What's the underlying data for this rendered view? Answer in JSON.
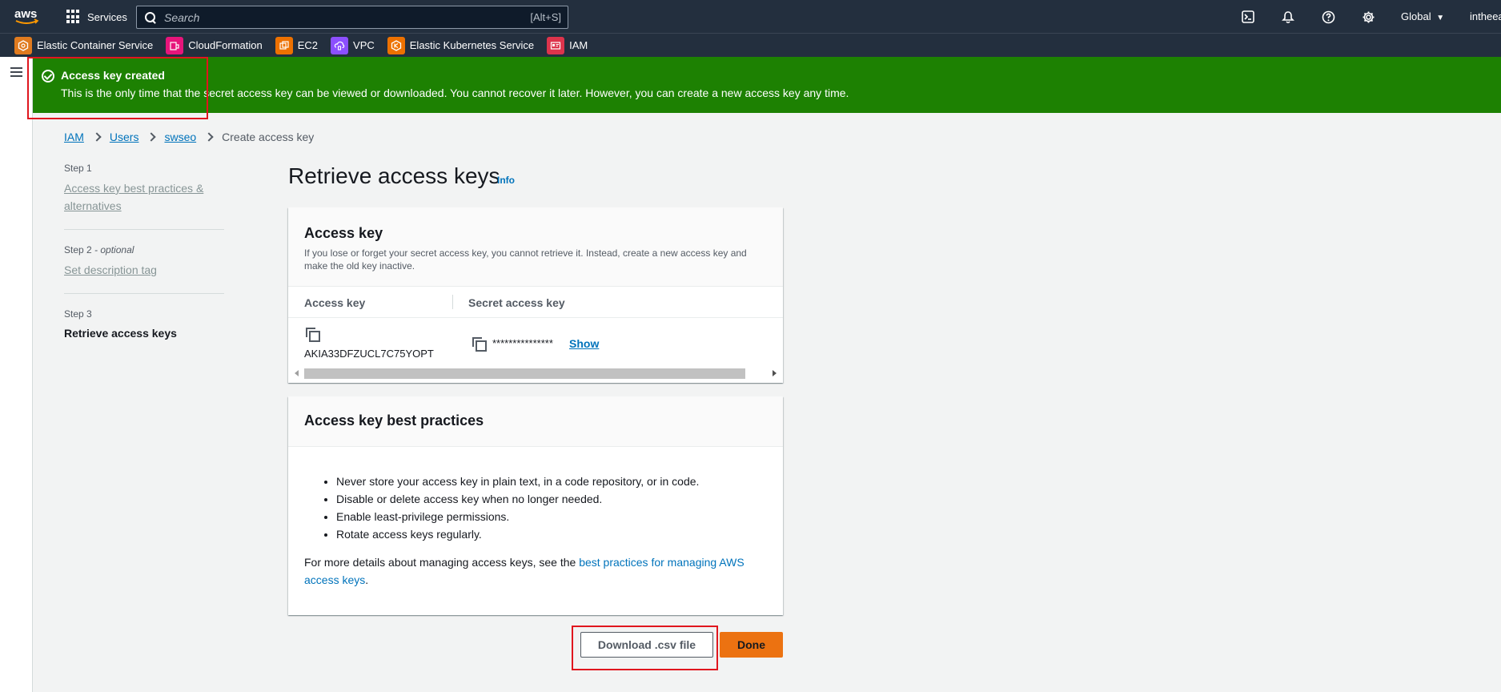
{
  "topnav": {
    "services_label": "Services",
    "search_placeholder": "Search",
    "search_shortcut": "[Alt+S]",
    "region": "Global",
    "user": "intheea"
  },
  "favorites": [
    {
      "label": "Elastic Container Service",
      "color": "#e07b1f"
    },
    {
      "label": "CloudFormation",
      "color": "#e7157b"
    },
    {
      "label": "EC2",
      "color": "#ed7100"
    },
    {
      "label": "VPC",
      "color": "#8c4fff"
    },
    {
      "label": "Elastic Kubernetes Service",
      "color": "#ed7100"
    },
    {
      "label": "IAM",
      "color": "#dd344c"
    }
  ],
  "flash": {
    "title": "Access key created",
    "message": "This is the only time that the secret access key can be viewed or downloaded. You cannot recover it later. However, you can create a new access key any time."
  },
  "breadcrumb": {
    "items": [
      "IAM",
      "Users",
      "swseo"
    ],
    "current": "Create access key"
  },
  "steps": [
    {
      "number": "Step 1",
      "label": "Access key best practices & alternatives"
    },
    {
      "number": "Step 2",
      "optional": "- optional",
      "label": "Set description tag"
    },
    {
      "number": "Step 3",
      "label": "Retrieve access keys"
    }
  ],
  "main": {
    "title": "Retrieve access keys",
    "info": "Info"
  },
  "access_key_card": {
    "title": "Access key",
    "description": "If you lose or forget your secret access key, you cannot retrieve it. Instead, create a new access key and make the old key inactive.",
    "columns": [
      "Access key",
      "Secret access key"
    ],
    "access_key_value": "AKIA33DFZUCL7C75YOPT",
    "secret_masked": "***************",
    "show_label": "Show"
  },
  "best_practices_card": {
    "title": "Access key best practices",
    "items": [
      "Never store your access key in plain text, in a code repository, or in code.",
      "Disable or delete access key when no longer needed.",
      "Enable least-privilege permissions.",
      "Rotate access keys regularly."
    ],
    "footer_prefix": "For more details about managing access keys, see the ",
    "footer_link": "best practices for managing AWS access keys",
    "footer_suffix": "."
  },
  "actions": {
    "download_label": "Download .csv file",
    "done_label": "Done"
  },
  "colors": {
    "nav_bg": "#232f3e",
    "flash_bg": "#1d8102",
    "link": "#0073bb",
    "primary_button": "#ec7211",
    "highlight_box": "#e0161e"
  }
}
